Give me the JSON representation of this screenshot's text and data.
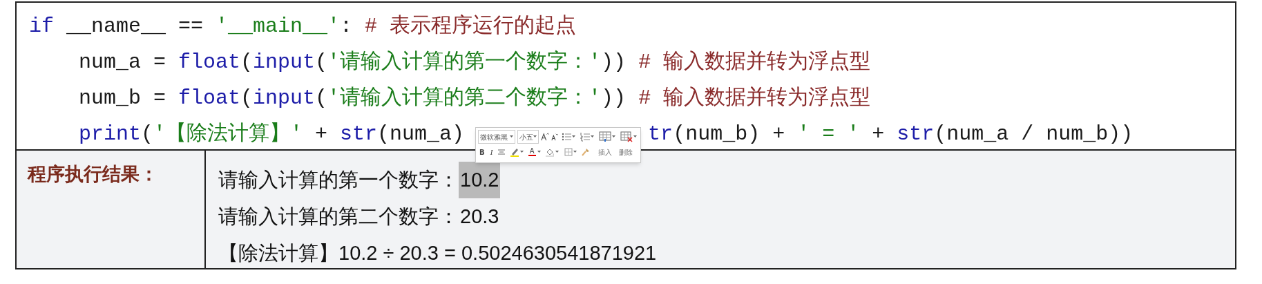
{
  "code_lines": [
    {
      "segments": [
        [
          {
            "kind": "keyword",
            "text": "if"
          },
          {
            "kind": "plain",
            "text": " __name__ == "
          },
          {
            "kind": "string",
            "text": "'__main__'"
          },
          {
            "kind": "plain",
            "text": ": "
          },
          {
            "kind": "comment",
            "text": "# 表示程序运行的起点"
          }
        ]
      ],
      "children": [
        {
          "segments": [
            [
              {
                "kind": "plain",
                "text": "num_a = "
              },
              {
                "kind": "keyword",
                "text": "float"
              },
              {
                "kind": "plain",
                "text": "("
              },
              {
                "kind": "keyword",
                "text": "input"
              },
              {
                "kind": "plain",
                "text": "("
              },
              {
                "kind": "string",
                "text": "'请输入计算的第一个数字：'"
              },
              {
                "kind": "plain",
                "text": ")) "
              },
              {
                "kind": "comment",
                "text": "# 输入数据并转为浮点型"
              }
            ]
          ]
        },
        {
          "segments": [
            [
              {
                "kind": "plain",
                "text": "num_b = "
              },
              {
                "kind": "keyword",
                "text": "float"
              },
              {
                "kind": "plain",
                "text": "("
              },
              {
                "kind": "keyword",
                "text": "input"
              },
              {
                "kind": "plain",
                "text": "("
              },
              {
                "kind": "string",
                "text": "'请输入计算的第二个数字：'"
              },
              {
                "kind": "plain",
                "text": ")) "
              },
              {
                "kind": "comment",
                "text": "# 输入数据并转为浮点型"
              }
            ]
          ]
        },
        {
          "segments": [
            [
              {
                "kind": "keyword",
                "text": "print"
              },
              {
                "kind": "plain",
                "text": "("
              },
              {
                "kind": "string",
                "text": "'【除法计算】'"
              },
              {
                "kind": "plain",
                "text": " + "
              },
              {
                "kind": "keyword",
                "text": "str"
              },
              {
                "kind": "plain",
                "text": "(num_a)"
              }
            ],
            [
              {
                "kind": "keyword",
                "text": "tr"
              },
              {
                "kind": "plain",
                "text": "(num_b) + "
              },
              {
                "kind": "string",
                "text": "' = '"
              },
              {
                "kind": "plain",
                "text": " + "
              },
              {
                "kind": "keyword",
                "text": "str"
              },
              {
                "kind": "plain",
                "text": "(num_a / num_b))"
              }
            ]
          ]
        }
      ]
    }
  ],
  "result": {
    "label": "程序执行结果：",
    "lines": [
      {
        "text": "请输入计算的第一个数字：",
        "input": "10.2",
        "input_selected": true
      },
      {
        "text": "请输入计算的第二个数字：",
        "input": "20.3",
        "input_selected": false
      },
      {
        "text": "【除法计算】10.2 ÷ 20.3 = 0.5024630541871921"
      }
    ]
  },
  "mini_toolbar": {
    "font": "微软雅黑",
    "size": "小五",
    "bold": "B",
    "italic": "I",
    "font_color": "A",
    "insert": "插入",
    "delete": "删除"
  }
}
